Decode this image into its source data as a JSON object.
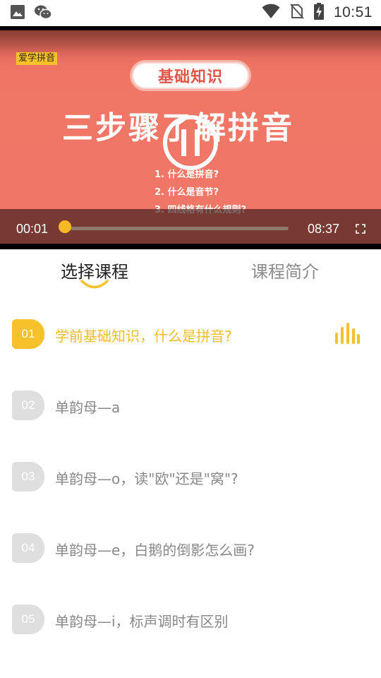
{
  "status_bar": {
    "time": "10:51",
    "left_icons": [
      "image-icon",
      "wechat-icon"
    ],
    "right_icons": [
      "wifi-icon",
      "no-sim-icon",
      "battery-charging-icon"
    ]
  },
  "video": {
    "brand_tag": "爱学拼音",
    "pill_text": "基础知识",
    "headline": "三步骤了解拼音",
    "steps": [
      "1. 什么是拼音?",
      "2. 什么是音节?",
      "3. 四线格有什么规则?"
    ],
    "current_time": "00:01",
    "duration": "08:37",
    "progress": 0.0,
    "accent": "#f6c12a"
  },
  "tabs": [
    {
      "label": "选择课程",
      "active": true
    },
    {
      "label": "课程简介",
      "active": false
    }
  ],
  "courses": [
    {
      "num": "01",
      "title": "学前基础知识，什么是拼音?",
      "active": true
    },
    {
      "num": "02",
      "title": "单韵母—a",
      "active": false
    },
    {
      "num": "03",
      "title": "单韵母—o，读\"欧\"还是\"窝\"?",
      "active": false
    },
    {
      "num": "04",
      "title": "单韵母—e，白鹅的倒影怎么画?",
      "active": false
    },
    {
      "num": "05",
      "title": "单韵母—i，标声调时有区别",
      "active": false
    }
  ]
}
